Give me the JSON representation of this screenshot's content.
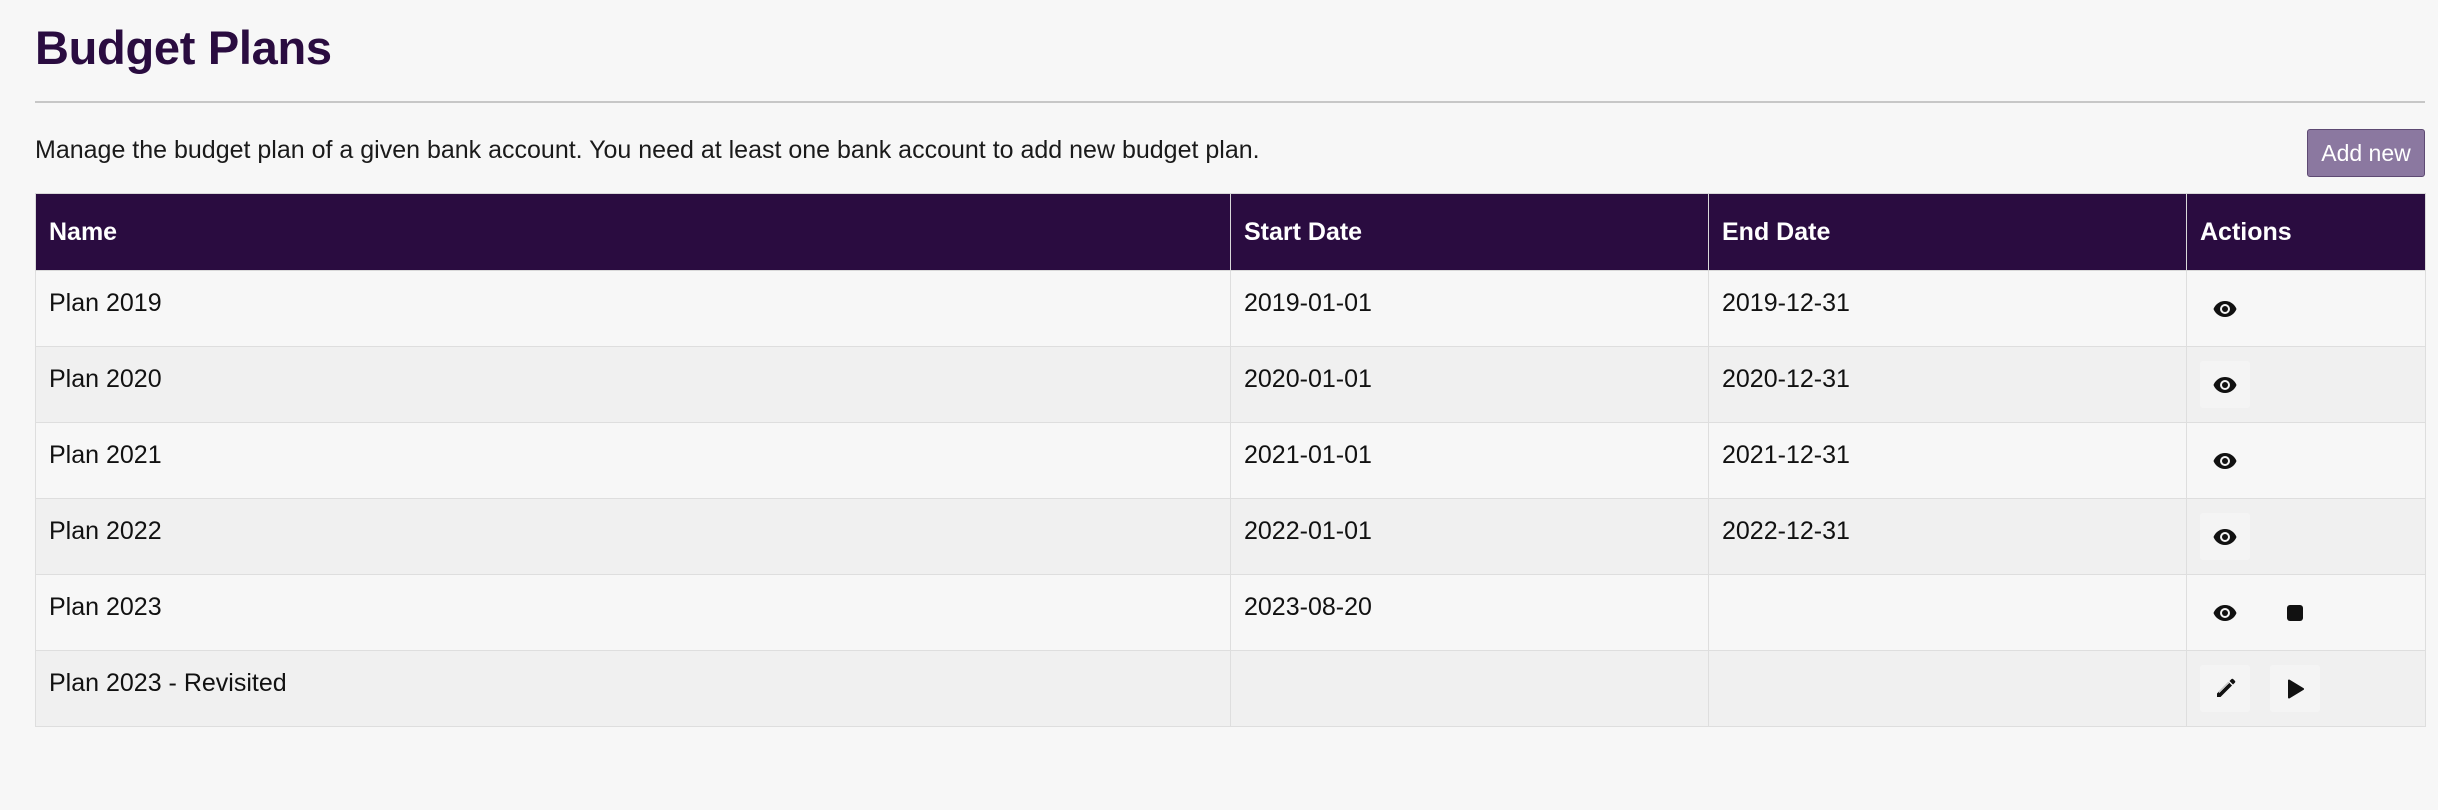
{
  "page": {
    "title": "Budget Plans",
    "description": "Manage the budget plan of a given bank account. You need at least one bank account to add new budget plan.",
    "add_button_label": "Add new"
  },
  "table": {
    "columns": [
      "Name",
      "Start Date",
      "End Date",
      "Actions"
    ],
    "rows": [
      {
        "name": "Plan 2019",
        "start": "2019-01-01",
        "end": "2019-12-31",
        "actions": [
          "view-icon"
        ]
      },
      {
        "name": "Plan 2020",
        "start": "2020-01-01",
        "end": "2020-12-31",
        "actions": [
          "view-icon"
        ]
      },
      {
        "name": "Plan 2021",
        "start": "2021-01-01",
        "end": "2021-12-31",
        "actions": [
          "view-icon"
        ]
      },
      {
        "name": "Plan 2022",
        "start": "2022-01-01",
        "end": "2022-12-31",
        "actions": [
          "view-icon"
        ]
      },
      {
        "name": "Plan 2023",
        "start": "2023-08-20",
        "end": "",
        "actions": [
          "view-icon",
          "stop-icon"
        ]
      },
      {
        "name": "Plan 2023 - Revisited",
        "start": "",
        "end": "",
        "actions": [
          "edit-icon",
          "play-icon"
        ]
      }
    ]
  },
  "colors": {
    "title": "#2a0c40",
    "header_bg": "#2a0c40",
    "header_text": "#ffffff",
    "button_bg": "#8b78a0",
    "background": "#f7f7f7"
  }
}
